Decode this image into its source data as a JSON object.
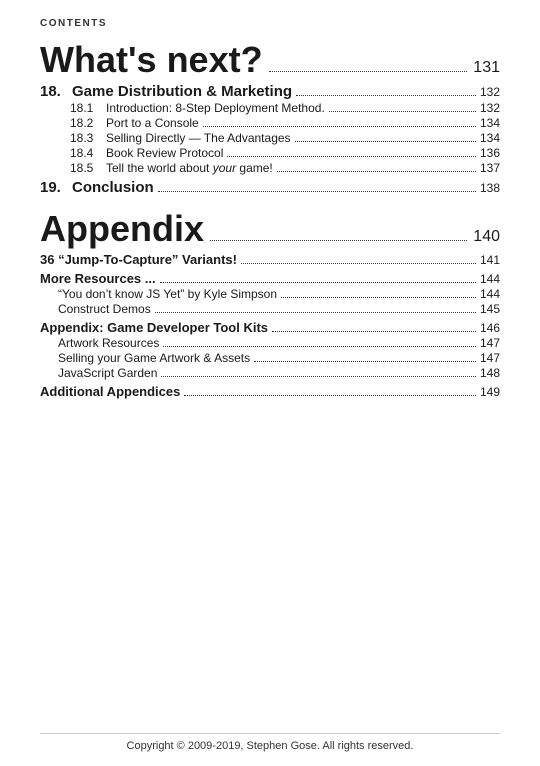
{
  "header": {
    "label": "CONTENTS"
  },
  "main_heading": {
    "text": "What's next?",
    "page": "131"
  },
  "sections": [
    {
      "number": "18.",
      "title": "Game Distribution & Marketing",
      "page": "132",
      "subsections": [
        {
          "number": "18.1",
          "title": "Introduction: 8-Step Deployment Method.",
          "page": "132"
        },
        {
          "number": "18.2",
          "title": "Port to a Console",
          "page": "134"
        },
        {
          "number": "18.3",
          "title": "Selling Directly — The Advantages",
          "page": "134"
        },
        {
          "number": "18.4",
          "title": "Book Review Protocol",
          "page": "136"
        },
        {
          "number": "18.5",
          "title": "Tell the world about",
          "title_em": "your",
          "title_end": " game!",
          "page": "137"
        }
      ]
    },
    {
      "number": "19.",
      "title": "Conclusion",
      "page": "138",
      "subsections": []
    }
  ],
  "appendix_heading": {
    "text": "Appendix",
    "page": "140"
  },
  "appendix_sections": [
    {
      "title": "36 “Jump-To-Capture” Variants!",
      "page": "141",
      "bold": true,
      "subsections": []
    },
    {
      "title": "More Resources",
      "page": "144",
      "bold": true,
      "ellipsis_after_title": true,
      "subsections": [
        {
          "title": "“You don’t know JS Yet” by Kyle Simpson",
          "page": "144"
        },
        {
          "title": "Construct Demos",
          "page": "145"
        }
      ]
    },
    {
      "title": "Appendix: Game Developer Tool Kits",
      "page": "146",
      "bold": true,
      "subsections": [
        {
          "title": "Artwork Resources",
          "page": "147"
        },
        {
          "title": "Selling your Game Artwork & Assets",
          "page": "147"
        },
        {
          "title": "JavaScript Garden",
          "page": "148"
        }
      ]
    },
    {
      "title": "Additional Appendices",
      "page": "149",
      "bold": true,
      "subsections": []
    }
  ],
  "footer": {
    "text": "Copyright © 2009-2019, Stephen Gose.  All rights reserved."
  }
}
